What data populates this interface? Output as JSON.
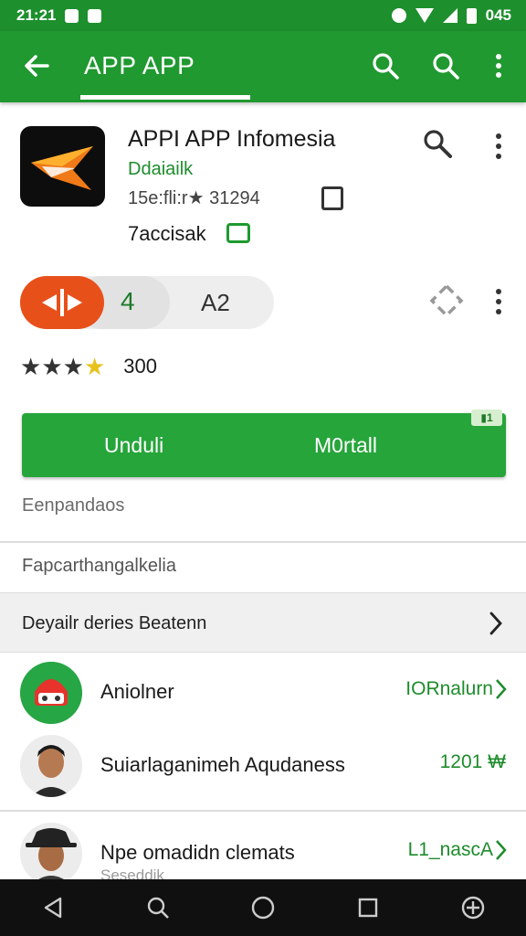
{
  "status_bar": {
    "time": "21:21",
    "right_text": "045"
  },
  "app_bar": {
    "title": "APP APP"
  },
  "app": {
    "name": "APPI APP Infomesia",
    "developer": "Ddaiailk",
    "meta": "15e:fli:r★ 31294",
    "tag": "7accisak"
  },
  "rating": {
    "pill_value_1": "4",
    "pill_value_2": "A2",
    "stars_filled": 3,
    "stars_total": 4,
    "count": "300"
  },
  "install_button": {
    "left_label": "Unduli",
    "right_label": "M0rtall",
    "badge": "▮1"
  },
  "sections": {
    "label_1": "Eenpandaos",
    "label_2": "Fapcarthangalkelia",
    "details_row": "Deyailr deries Beatenn"
  },
  "list": [
    {
      "name": "Aniolner",
      "value": "IORnalurn",
      "sub": ""
    },
    {
      "name": "Suiarlaganimeh Aqudaness",
      "value": "1201 ₩",
      "sub": ""
    },
    {
      "name": "Npe omadidn clemats",
      "value": "L1_nascA",
      "sub": "Seseddik"
    }
  ],
  "colors": {
    "primary": "#1f9930",
    "status": "#1d8f2d",
    "accent_orange": "#e8501a",
    "install": "#26a53a",
    "link_green": "#1e8c2c"
  }
}
